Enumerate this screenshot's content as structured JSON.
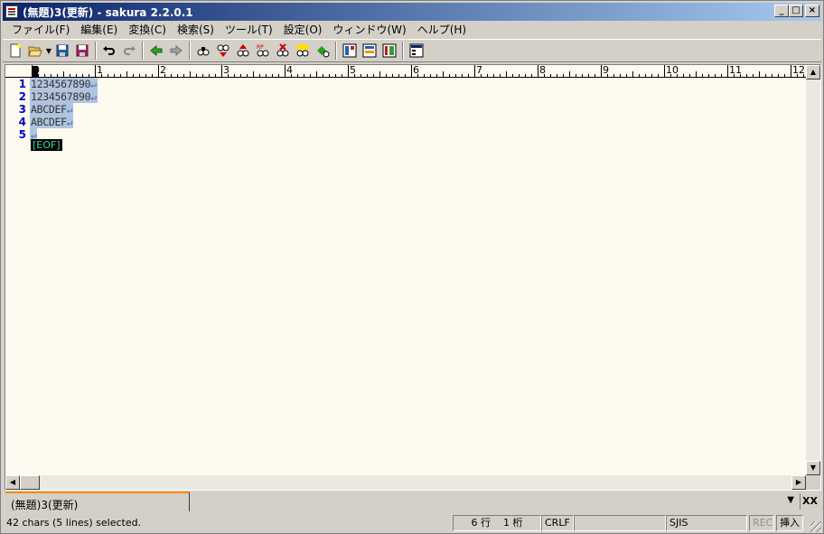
{
  "window": {
    "title": "(無題)3(更新) - sakura 2.2.0.1",
    "min_label": "_",
    "max_label": "□",
    "close_label": "×"
  },
  "menu": [
    "ファイル(F)",
    "編集(E)",
    "変換(C)",
    "検索(S)",
    "ツール(T)",
    "設定(O)",
    "ウィンドウ(W)",
    "ヘルプ(H)"
  ],
  "toolbar": {
    "icons": [
      "new-file-icon",
      "open-file-icon",
      "save-icon",
      "save-all-icon",
      "undo-icon",
      "redo-icon",
      "jump-back-icon",
      "jump-forward-icon",
      "search-icon",
      "find-prev-icon",
      "find-next-icon",
      "replace-icon",
      "clear-highlight-icon",
      "bookmark-icon",
      "grep-icon",
      "outline-icon",
      "settings-icon",
      "font-icon",
      "window-list-icon"
    ]
  },
  "ruler": {
    "labels": [
      "0",
      "1",
      "2",
      "3",
      "4",
      "5",
      "6",
      "7",
      "8",
      "9",
      "10",
      "11",
      "12"
    ]
  },
  "editor": {
    "lines": [
      {
        "no": "1",
        "text": "1234567890",
        "eol": "↵"
      },
      {
        "no": "2",
        "text": "1234567890",
        "eol": "↵"
      },
      {
        "no": "3",
        "text": "ABCDEF",
        "eol": "↵"
      },
      {
        "no": "4",
        "text": "ABCDEF",
        "eol": "↵"
      },
      {
        "no": "5",
        "text": "",
        "eol": "↵"
      }
    ],
    "eof": "[EOF]"
  },
  "tabs": {
    "active": "(無題)3(更新)",
    "dropdown": "▼",
    "close": "XX"
  },
  "status": {
    "message": "42 chars (5 lines) selected.",
    "row": "6 行",
    "col": "1 桁",
    "eol_type": "CRLF",
    "blank": "",
    "encoding": "SJIS",
    "rec": "REC",
    "mode": "挿入"
  },
  "colors": {
    "title_start": "#0a246a",
    "title_end": "#a6caf0",
    "editor_bg": "#fdfaf0",
    "selection": "#b0c4de",
    "line_number": "#0000cc",
    "eof_fg": "#39d9a8",
    "tab_accent": "#ff8a00"
  }
}
